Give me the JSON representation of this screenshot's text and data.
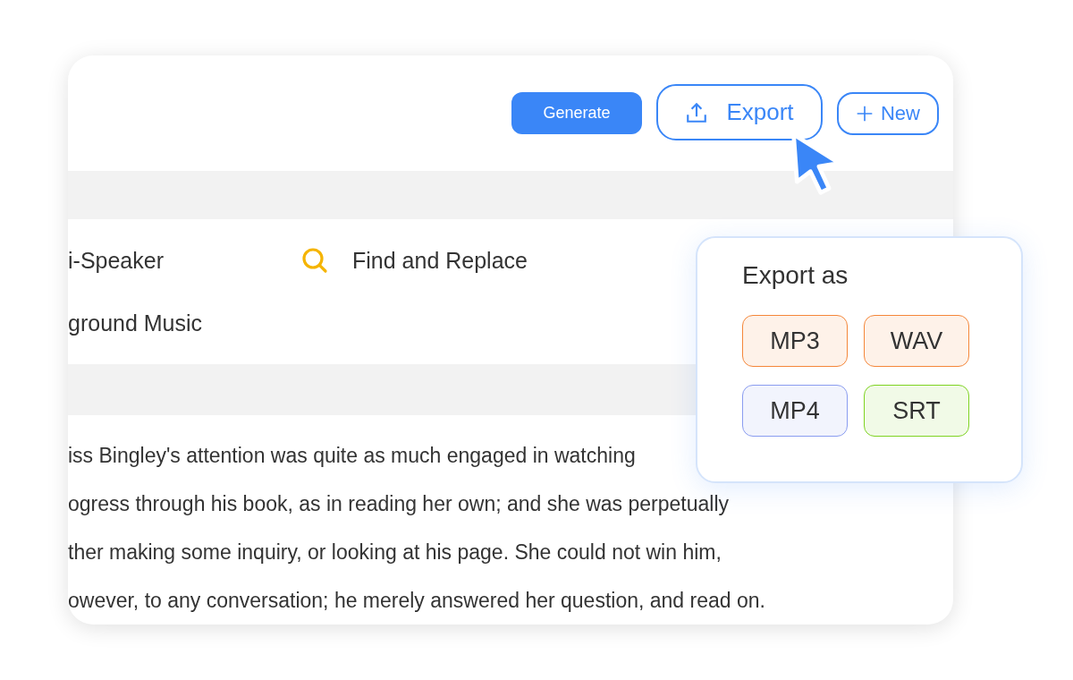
{
  "toolbar": {
    "buttons": [
      {
        "label": "Generate",
        "kind": "primary"
      },
      {
        "label": "Export",
        "kind": "export"
      },
      {
        "label": "New",
        "kind": "new"
      }
    ]
  },
  "tools": [
    {
      "label": "i-Speaker",
      "kind": "plain"
    },
    {
      "label": "Find and Replace",
      "kind": "search"
    },
    {
      "label": "ground Music",
      "kind": "plain"
    }
  ],
  "paragraph": [
    "iss Bingley's attention was quite as much engaged in watching",
    "ogress through his book, as in reading her own; and she was perpetually",
    "ther making some inquiry, or looking at his page. She could not win him,",
    "owever, to any conversation; he merely answered her question, and read on."
  ],
  "export_menu": {
    "title": "Export as",
    "formats": [
      {
        "label": "MP3",
        "color": "#f5873a"
      },
      {
        "label": "WAV",
        "color": "#f5873a"
      },
      {
        "label": "MP4",
        "color": "#8a9cf0"
      },
      {
        "label": "SRT",
        "color": "#7ed321"
      }
    ]
  }
}
